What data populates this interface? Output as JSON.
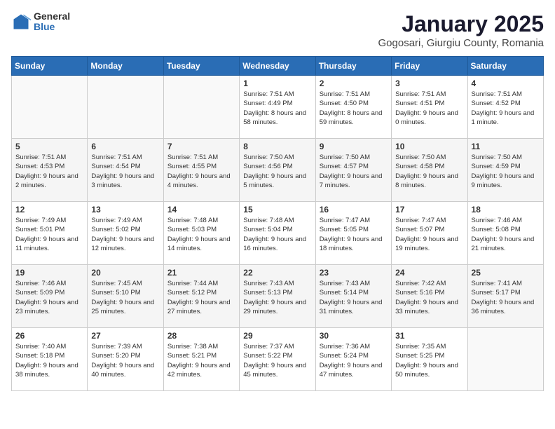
{
  "logo": {
    "general": "General",
    "blue": "Blue"
  },
  "title": "January 2025",
  "subtitle": "Gogosari, Giurgiu County, Romania",
  "headers": [
    "Sunday",
    "Monday",
    "Tuesday",
    "Wednesday",
    "Thursday",
    "Friday",
    "Saturday"
  ],
  "weeks": [
    [
      {
        "num": "",
        "sunrise": "",
        "sunset": "",
        "daylight": ""
      },
      {
        "num": "",
        "sunrise": "",
        "sunset": "",
        "daylight": ""
      },
      {
        "num": "",
        "sunrise": "",
        "sunset": "",
        "daylight": ""
      },
      {
        "num": "1",
        "sunrise": "Sunrise: 7:51 AM",
        "sunset": "Sunset: 4:49 PM",
        "daylight": "Daylight: 8 hours and 58 minutes."
      },
      {
        "num": "2",
        "sunrise": "Sunrise: 7:51 AM",
        "sunset": "Sunset: 4:50 PM",
        "daylight": "Daylight: 8 hours and 59 minutes."
      },
      {
        "num": "3",
        "sunrise": "Sunrise: 7:51 AM",
        "sunset": "Sunset: 4:51 PM",
        "daylight": "Daylight: 9 hours and 0 minutes."
      },
      {
        "num": "4",
        "sunrise": "Sunrise: 7:51 AM",
        "sunset": "Sunset: 4:52 PM",
        "daylight": "Daylight: 9 hours and 1 minute."
      }
    ],
    [
      {
        "num": "5",
        "sunrise": "Sunrise: 7:51 AM",
        "sunset": "Sunset: 4:53 PM",
        "daylight": "Daylight: 9 hours and 2 minutes."
      },
      {
        "num": "6",
        "sunrise": "Sunrise: 7:51 AM",
        "sunset": "Sunset: 4:54 PM",
        "daylight": "Daylight: 9 hours and 3 minutes."
      },
      {
        "num": "7",
        "sunrise": "Sunrise: 7:51 AM",
        "sunset": "Sunset: 4:55 PM",
        "daylight": "Daylight: 9 hours and 4 minutes."
      },
      {
        "num": "8",
        "sunrise": "Sunrise: 7:50 AM",
        "sunset": "Sunset: 4:56 PM",
        "daylight": "Daylight: 9 hours and 5 minutes."
      },
      {
        "num": "9",
        "sunrise": "Sunrise: 7:50 AM",
        "sunset": "Sunset: 4:57 PM",
        "daylight": "Daylight: 9 hours and 7 minutes."
      },
      {
        "num": "10",
        "sunrise": "Sunrise: 7:50 AM",
        "sunset": "Sunset: 4:58 PM",
        "daylight": "Daylight: 9 hours and 8 minutes."
      },
      {
        "num": "11",
        "sunrise": "Sunrise: 7:50 AM",
        "sunset": "Sunset: 4:59 PM",
        "daylight": "Daylight: 9 hours and 9 minutes."
      }
    ],
    [
      {
        "num": "12",
        "sunrise": "Sunrise: 7:49 AM",
        "sunset": "Sunset: 5:01 PM",
        "daylight": "Daylight: 9 hours and 11 minutes."
      },
      {
        "num": "13",
        "sunrise": "Sunrise: 7:49 AM",
        "sunset": "Sunset: 5:02 PM",
        "daylight": "Daylight: 9 hours and 12 minutes."
      },
      {
        "num": "14",
        "sunrise": "Sunrise: 7:48 AM",
        "sunset": "Sunset: 5:03 PM",
        "daylight": "Daylight: 9 hours and 14 minutes."
      },
      {
        "num": "15",
        "sunrise": "Sunrise: 7:48 AM",
        "sunset": "Sunset: 5:04 PM",
        "daylight": "Daylight: 9 hours and 16 minutes."
      },
      {
        "num": "16",
        "sunrise": "Sunrise: 7:47 AM",
        "sunset": "Sunset: 5:05 PM",
        "daylight": "Daylight: 9 hours and 18 minutes."
      },
      {
        "num": "17",
        "sunrise": "Sunrise: 7:47 AM",
        "sunset": "Sunset: 5:07 PM",
        "daylight": "Daylight: 9 hours and 19 minutes."
      },
      {
        "num": "18",
        "sunrise": "Sunrise: 7:46 AM",
        "sunset": "Sunset: 5:08 PM",
        "daylight": "Daylight: 9 hours and 21 minutes."
      }
    ],
    [
      {
        "num": "19",
        "sunrise": "Sunrise: 7:46 AM",
        "sunset": "Sunset: 5:09 PM",
        "daylight": "Daylight: 9 hours and 23 minutes."
      },
      {
        "num": "20",
        "sunrise": "Sunrise: 7:45 AM",
        "sunset": "Sunset: 5:10 PM",
        "daylight": "Daylight: 9 hours and 25 minutes."
      },
      {
        "num": "21",
        "sunrise": "Sunrise: 7:44 AM",
        "sunset": "Sunset: 5:12 PM",
        "daylight": "Daylight: 9 hours and 27 minutes."
      },
      {
        "num": "22",
        "sunrise": "Sunrise: 7:43 AM",
        "sunset": "Sunset: 5:13 PM",
        "daylight": "Daylight: 9 hours and 29 minutes."
      },
      {
        "num": "23",
        "sunrise": "Sunrise: 7:43 AM",
        "sunset": "Sunset: 5:14 PM",
        "daylight": "Daylight: 9 hours and 31 minutes."
      },
      {
        "num": "24",
        "sunrise": "Sunrise: 7:42 AM",
        "sunset": "Sunset: 5:16 PM",
        "daylight": "Daylight: 9 hours and 33 minutes."
      },
      {
        "num": "25",
        "sunrise": "Sunrise: 7:41 AM",
        "sunset": "Sunset: 5:17 PM",
        "daylight": "Daylight: 9 hours and 36 minutes."
      }
    ],
    [
      {
        "num": "26",
        "sunrise": "Sunrise: 7:40 AM",
        "sunset": "Sunset: 5:18 PM",
        "daylight": "Daylight: 9 hours and 38 minutes."
      },
      {
        "num": "27",
        "sunrise": "Sunrise: 7:39 AM",
        "sunset": "Sunset: 5:20 PM",
        "daylight": "Daylight: 9 hours and 40 minutes."
      },
      {
        "num": "28",
        "sunrise": "Sunrise: 7:38 AM",
        "sunset": "Sunset: 5:21 PM",
        "daylight": "Daylight: 9 hours and 42 minutes."
      },
      {
        "num": "29",
        "sunrise": "Sunrise: 7:37 AM",
        "sunset": "Sunset: 5:22 PM",
        "daylight": "Daylight: 9 hours and 45 minutes."
      },
      {
        "num": "30",
        "sunrise": "Sunrise: 7:36 AM",
        "sunset": "Sunset: 5:24 PM",
        "daylight": "Daylight: 9 hours and 47 minutes."
      },
      {
        "num": "31",
        "sunrise": "Sunrise: 7:35 AM",
        "sunset": "Sunset: 5:25 PM",
        "daylight": "Daylight: 9 hours and 50 minutes."
      },
      {
        "num": "",
        "sunrise": "",
        "sunset": "",
        "daylight": ""
      }
    ]
  ]
}
